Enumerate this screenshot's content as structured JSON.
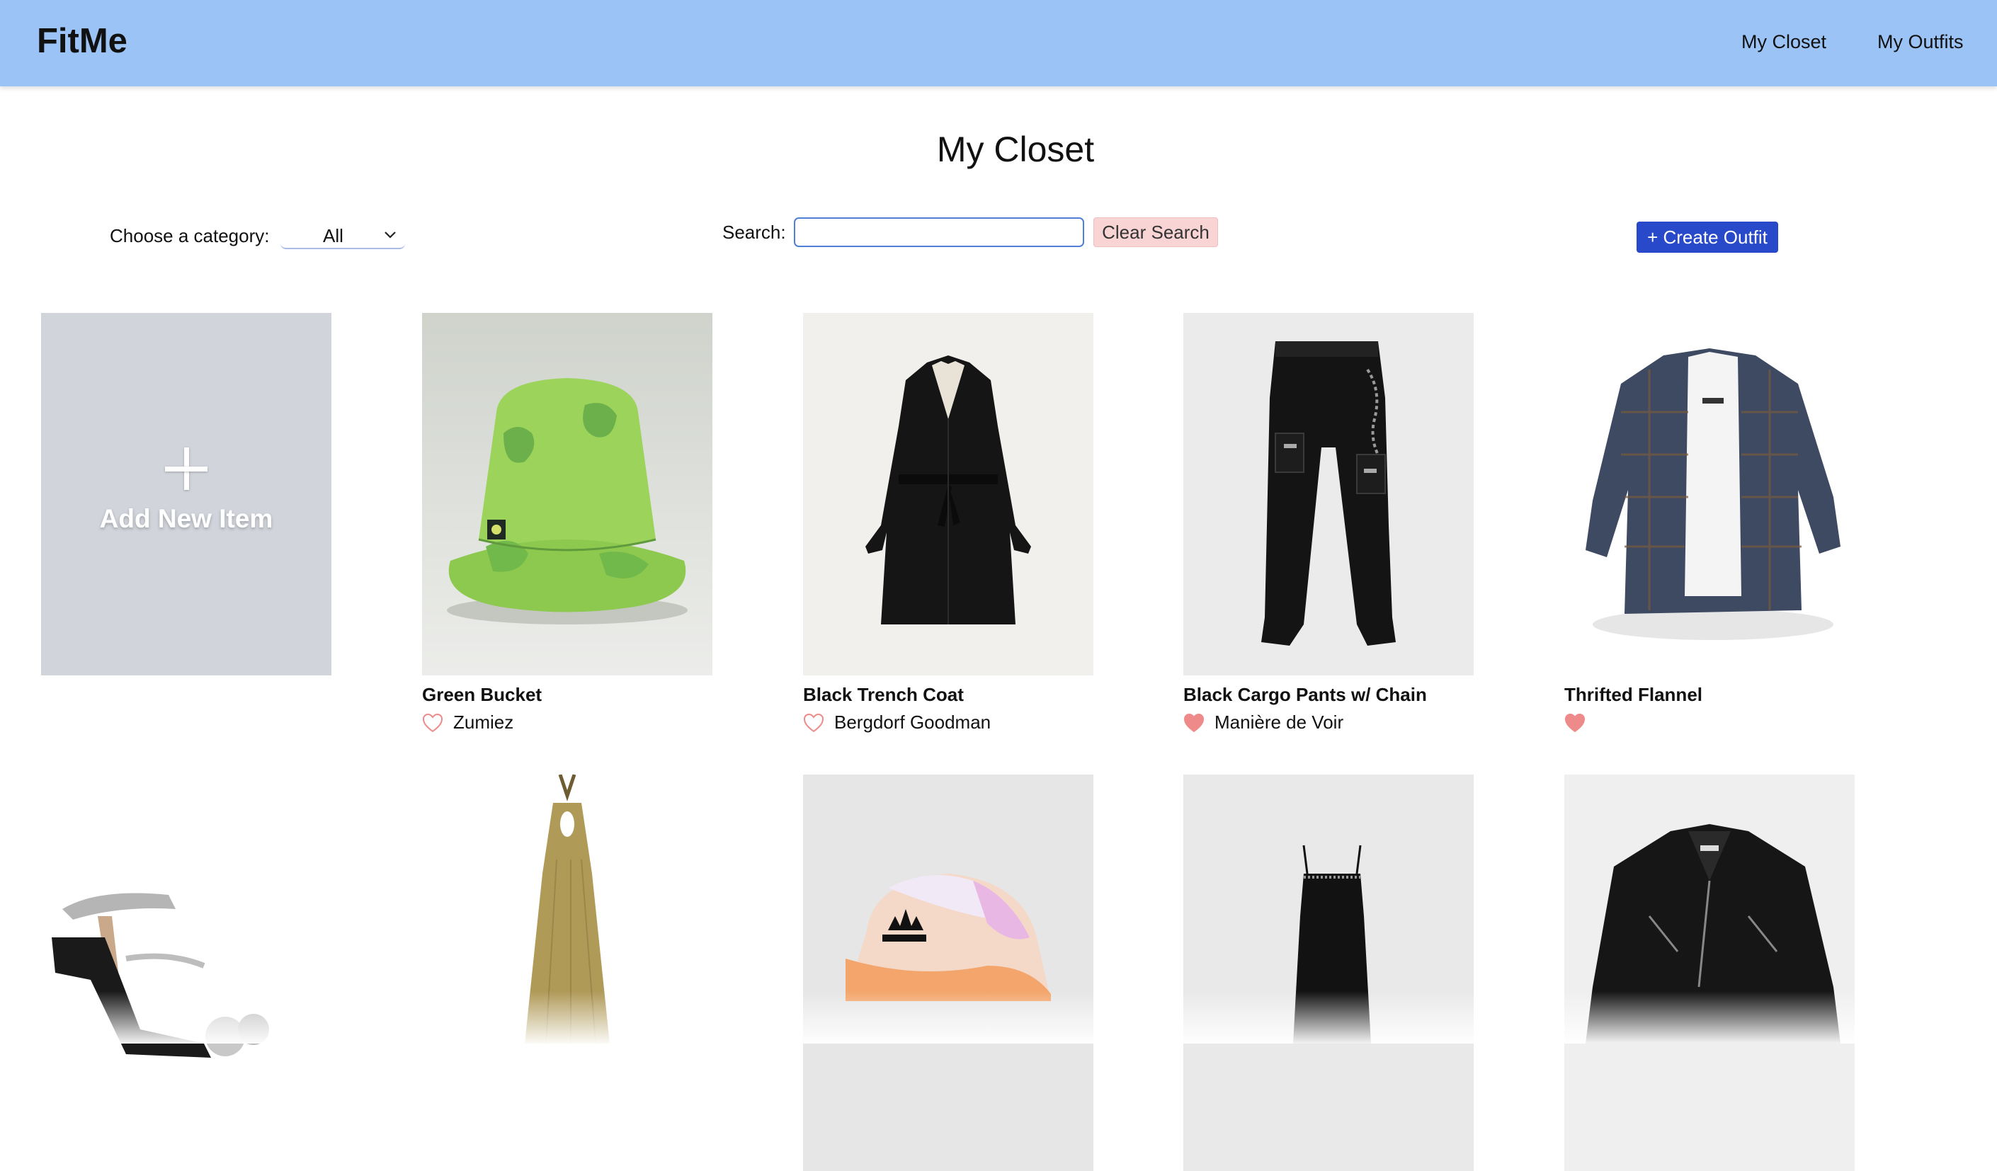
{
  "app": {
    "brand": "FitMe",
    "nav": [
      {
        "label": "My Closet"
      },
      {
        "label": "My Outfits"
      }
    ]
  },
  "page": {
    "title": "My Closet"
  },
  "controls": {
    "category_label": "Choose a category:",
    "category_value": "All",
    "search_label": "Search:",
    "search_value": "",
    "search_placeholder": "",
    "clear_label": "Clear Search",
    "create_label": "+ Create Outfit"
  },
  "add_card": {
    "label": "Add New Item"
  },
  "items": [
    {
      "name": "Green Bucket",
      "brand": "Zumiez",
      "favorite": false
    },
    {
      "name": "Black Trench Coat",
      "brand": "Bergdorf Goodman",
      "favorite": false
    },
    {
      "name": "Black Cargo Pants w/ Chain",
      "brand": "Manière de Voir",
      "favorite": true
    },
    {
      "name": "Thrifted Flannel",
      "brand": "",
      "favorite": true
    }
  ],
  "row2_items": [
    {
      "image": "silver-heels"
    },
    {
      "image": "gold-halter-dress"
    },
    {
      "image": "tie-dye-bucket-hat"
    },
    {
      "image": "black-slip-dress"
    },
    {
      "image": "black-leather-jacket"
    }
  ],
  "colors": {
    "topbar": "#9bc3f6",
    "create_button": "#2849c9",
    "clear_button": "#f8d4d4",
    "heart": "#ef8a8a",
    "add_card": "#d1d5db"
  }
}
